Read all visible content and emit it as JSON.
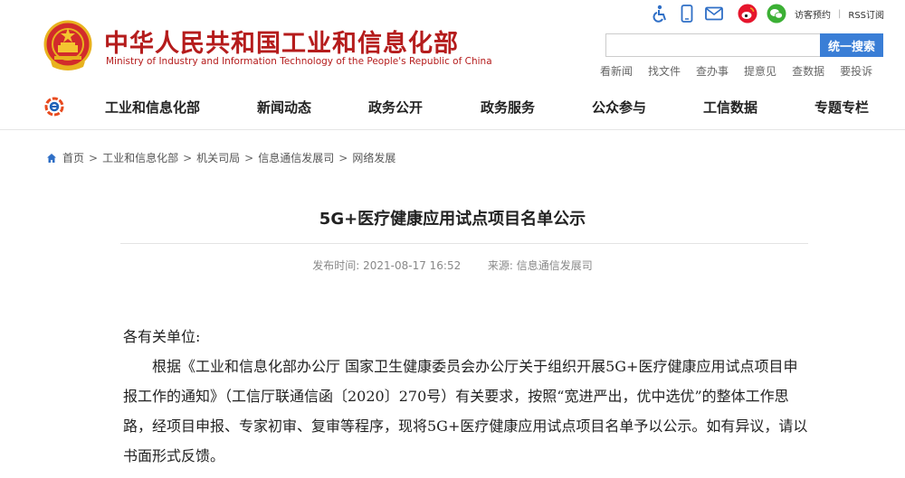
{
  "header": {
    "title_cn": "中华人民共和国工业和信息化部",
    "title_en": "Ministry of Industry and Information Technology of the People's Republic of China",
    "top_links": {
      "visit": "访客预约",
      "rss": "RSS订阅"
    },
    "icons": [
      "accessibility-icon",
      "mobile-icon",
      "mail-icon",
      "weibo-icon",
      "wechat-icon"
    ],
    "search": {
      "placeholder": "",
      "button_label": "统一搜索"
    },
    "quick_links": [
      "看新闻",
      "找文件",
      "查办事",
      "提意见",
      "查数据",
      "要投诉"
    ]
  },
  "nav": {
    "items": [
      "工业和信息化部",
      "新闻动态",
      "政务公开",
      "政务服务",
      "公众参与",
      "工信数据",
      "专题专栏"
    ]
  },
  "breadcrumb": [
    "首页",
    "工业和信息化部",
    "机关司局",
    "信息通信发展司",
    "网络发展"
  ],
  "article": {
    "title": "5G+医疗健康应用试点项目名单公示",
    "publish_label": "发布时间:",
    "publish_time": "2021-08-17 16:52",
    "source_label": "来源:",
    "source": "信息通信发展司",
    "greeting": "各有关单位:",
    "paragraph": "根据《工业和信息化部办公厅 国家卫生健康委员会办公厅关于组织开展5G+医疗健康应用试点项目申报工作的通知》（工信厅联通信函〔2020〕270号）有关要求，按照“宽进严出，优中选优”的整体工作思路，经项目申报、专家初审、复审等程序，现将5G+医疗健康应用试点项目名单予以公示。如有异议，请以书面形式反馈。"
  },
  "colors": {
    "brand_red": "#b51c1c",
    "search_blue": "#3a7ed6",
    "icon_blue": "#2f6fc6",
    "weibo_red": "#e6162d",
    "wechat_green": "#3cb035"
  }
}
